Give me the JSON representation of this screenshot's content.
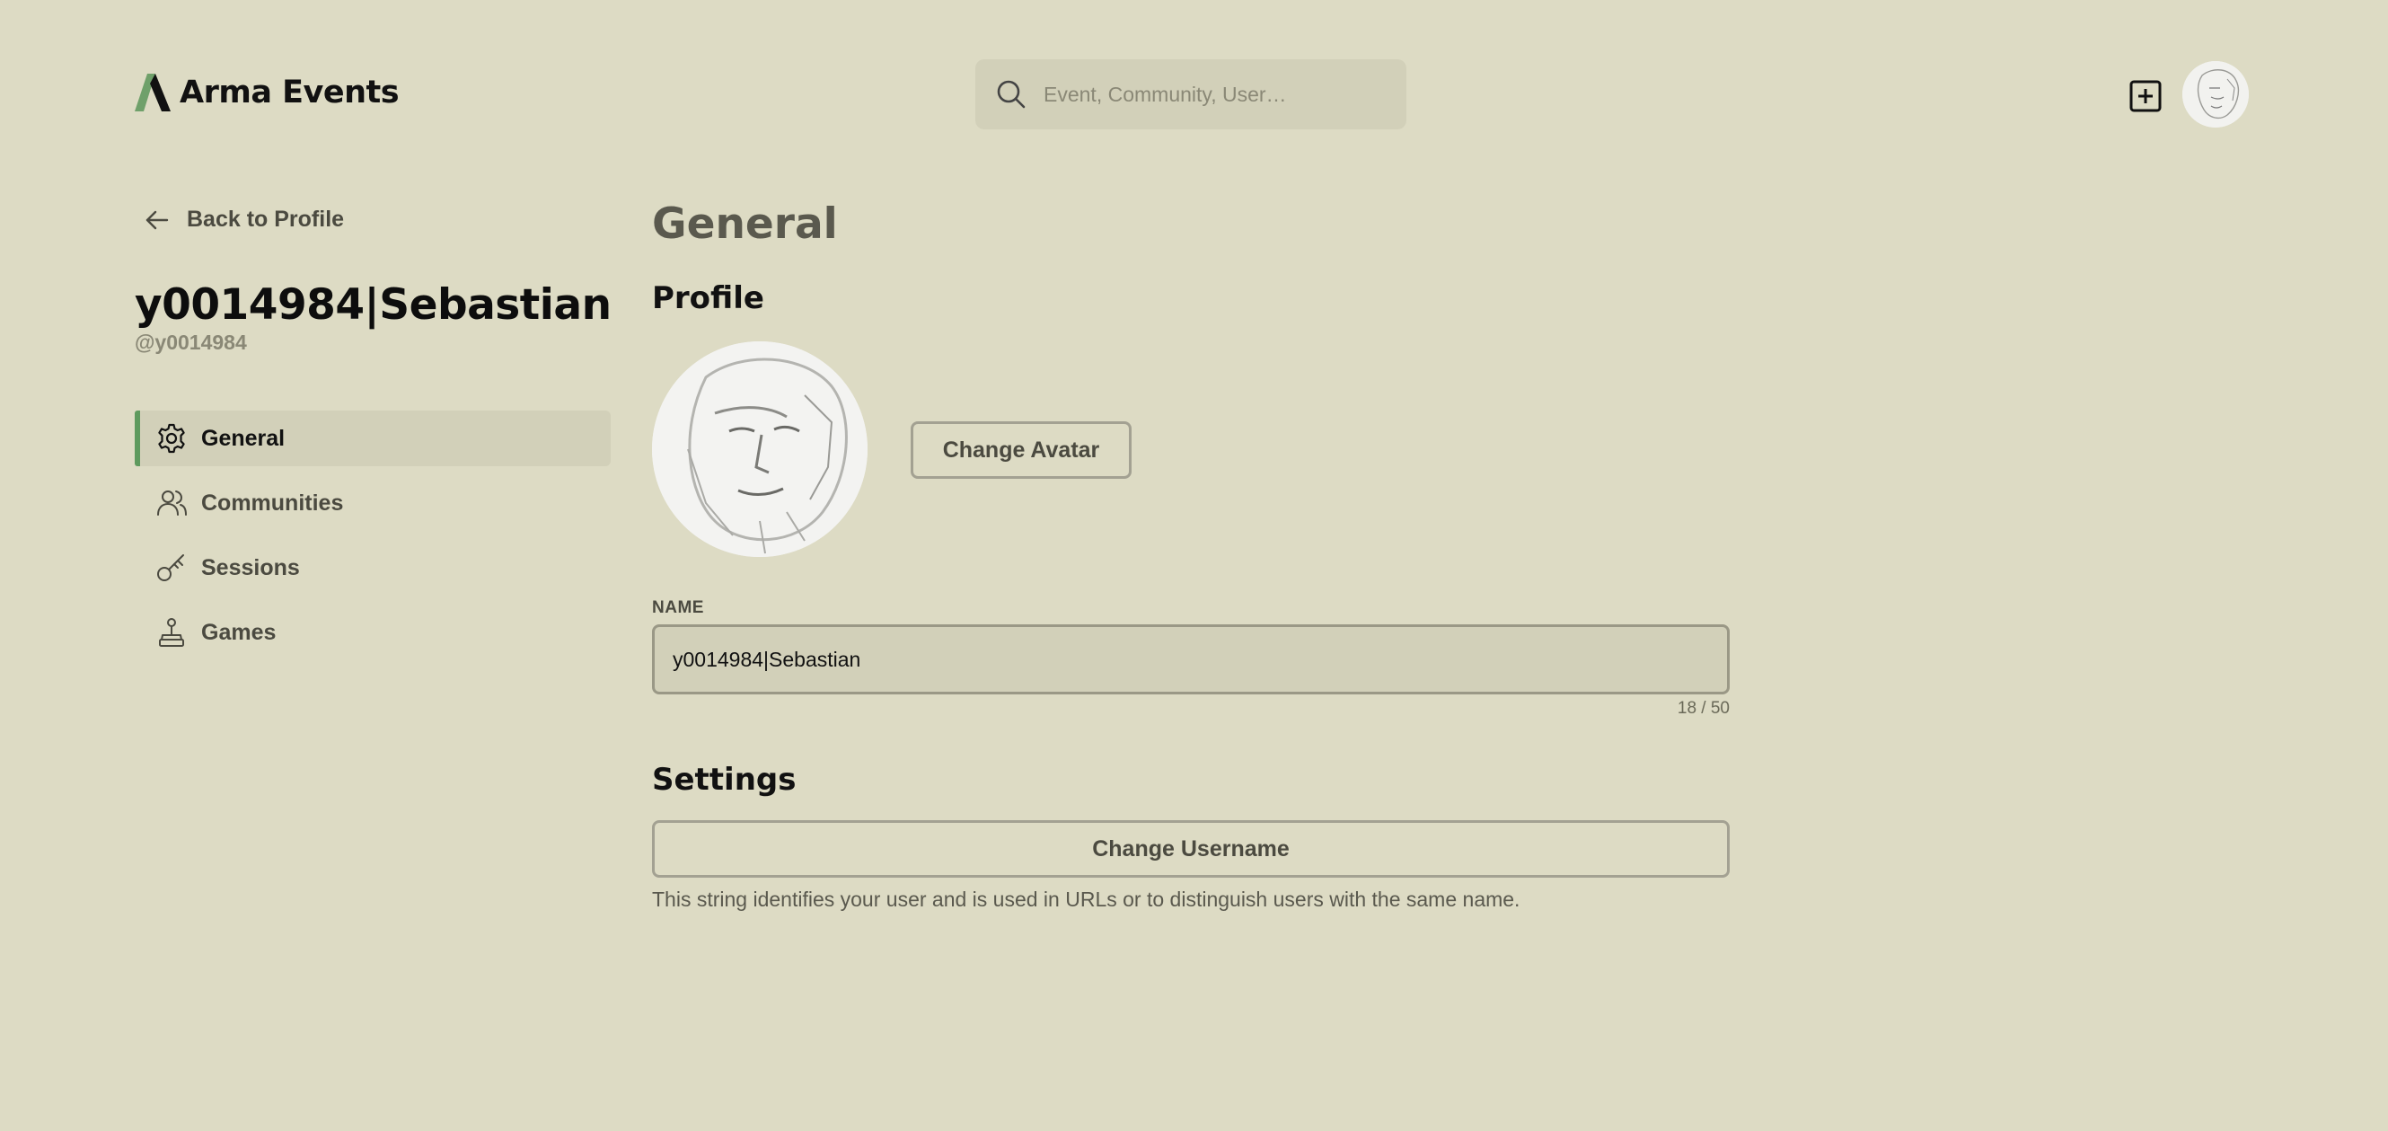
{
  "header": {
    "brand_name": "Arma Events",
    "search_placeholder": "Event, Community, User…",
    "icons": {
      "logo": "arma-logo-icon",
      "search": "search-icon",
      "new": "plus-square-icon",
      "avatar": "user-avatar"
    }
  },
  "sidebar": {
    "back_label": "Back to Profile",
    "user_name": "y0014984|Sebastian",
    "user_handle": "@y0014984",
    "items": [
      {
        "label": "General",
        "icon": "gear-icon",
        "active": true
      },
      {
        "label": "Communities",
        "icon": "users-icon",
        "active": false
      },
      {
        "label": "Sessions",
        "icon": "key-icon",
        "active": false
      },
      {
        "label": "Games",
        "icon": "joystick-icon",
        "active": false
      }
    ]
  },
  "main": {
    "title": "General",
    "profile_heading": "Profile",
    "change_avatar_label": "Change Avatar",
    "name_label": "NAME",
    "name_value": "y0014984|Sebastian",
    "name_counter": "18 / 50",
    "settings_heading": "Settings",
    "change_username_label": "Change Username",
    "username_hint": "This string identifies your user and is used in URLs or to distinguish users with the same name."
  },
  "colors": {
    "background": "#dddbc4",
    "surface": "#d2d0b9",
    "accent": "#5e9a5e",
    "border": "#a3a192"
  }
}
